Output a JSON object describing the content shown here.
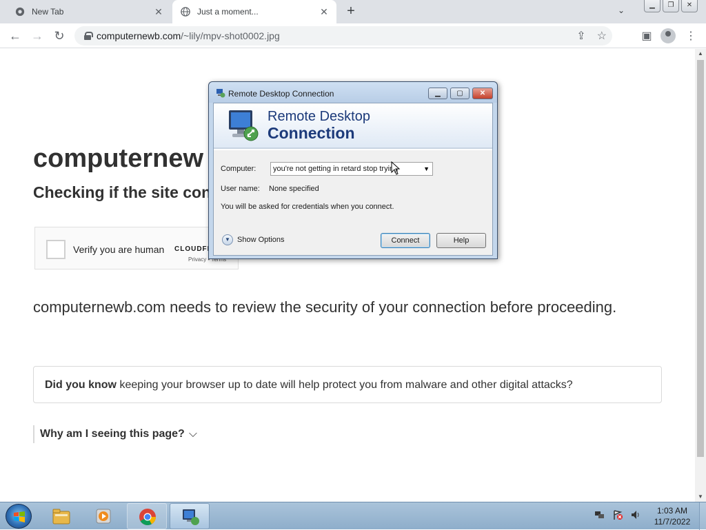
{
  "browser": {
    "tabs": [
      {
        "title": "New Tab",
        "icon": "chrome-icon"
      },
      {
        "title": "Just a moment...",
        "icon": "globe-icon"
      }
    ],
    "url_host": "computernewb.com",
    "url_path": "/~lily/mpv-shot0002.jpg"
  },
  "page": {
    "heading": "computernew",
    "subheading": "Checking if the site con",
    "captcha": {
      "label": "Verify you are human",
      "logo": "CLOUDFL",
      "links": "Privacy • Terms"
    },
    "message": "computernewb.com needs to review the security of your connection before proceeding.",
    "did_you_know_bold": "Did you know",
    "did_you_know_text": " keeping your browser up to date will help protect you from malware and other digital attacks?",
    "why_label": "Why am I seeing this page?"
  },
  "rdp": {
    "window_title": "Remote Desktop Connection",
    "banner_line1": "Remote Desktop",
    "banner_line2": "Connection",
    "computer_label": "Computer:",
    "computer_value": "you're not getting in retard stop trying",
    "username_label": "User name:",
    "username_value": "None specified",
    "info": "You will be asked for credentials when you connect.",
    "show_options": "Show Options",
    "connect": "Connect",
    "help": "Help"
  },
  "taskbar": {
    "time": "1:03 AM",
    "date": "11/7/2022"
  },
  "colors": {
    "rdp_banner_text": "#1c3a7a",
    "taskbar": "#9ab8d4",
    "page_text": "#313131"
  }
}
